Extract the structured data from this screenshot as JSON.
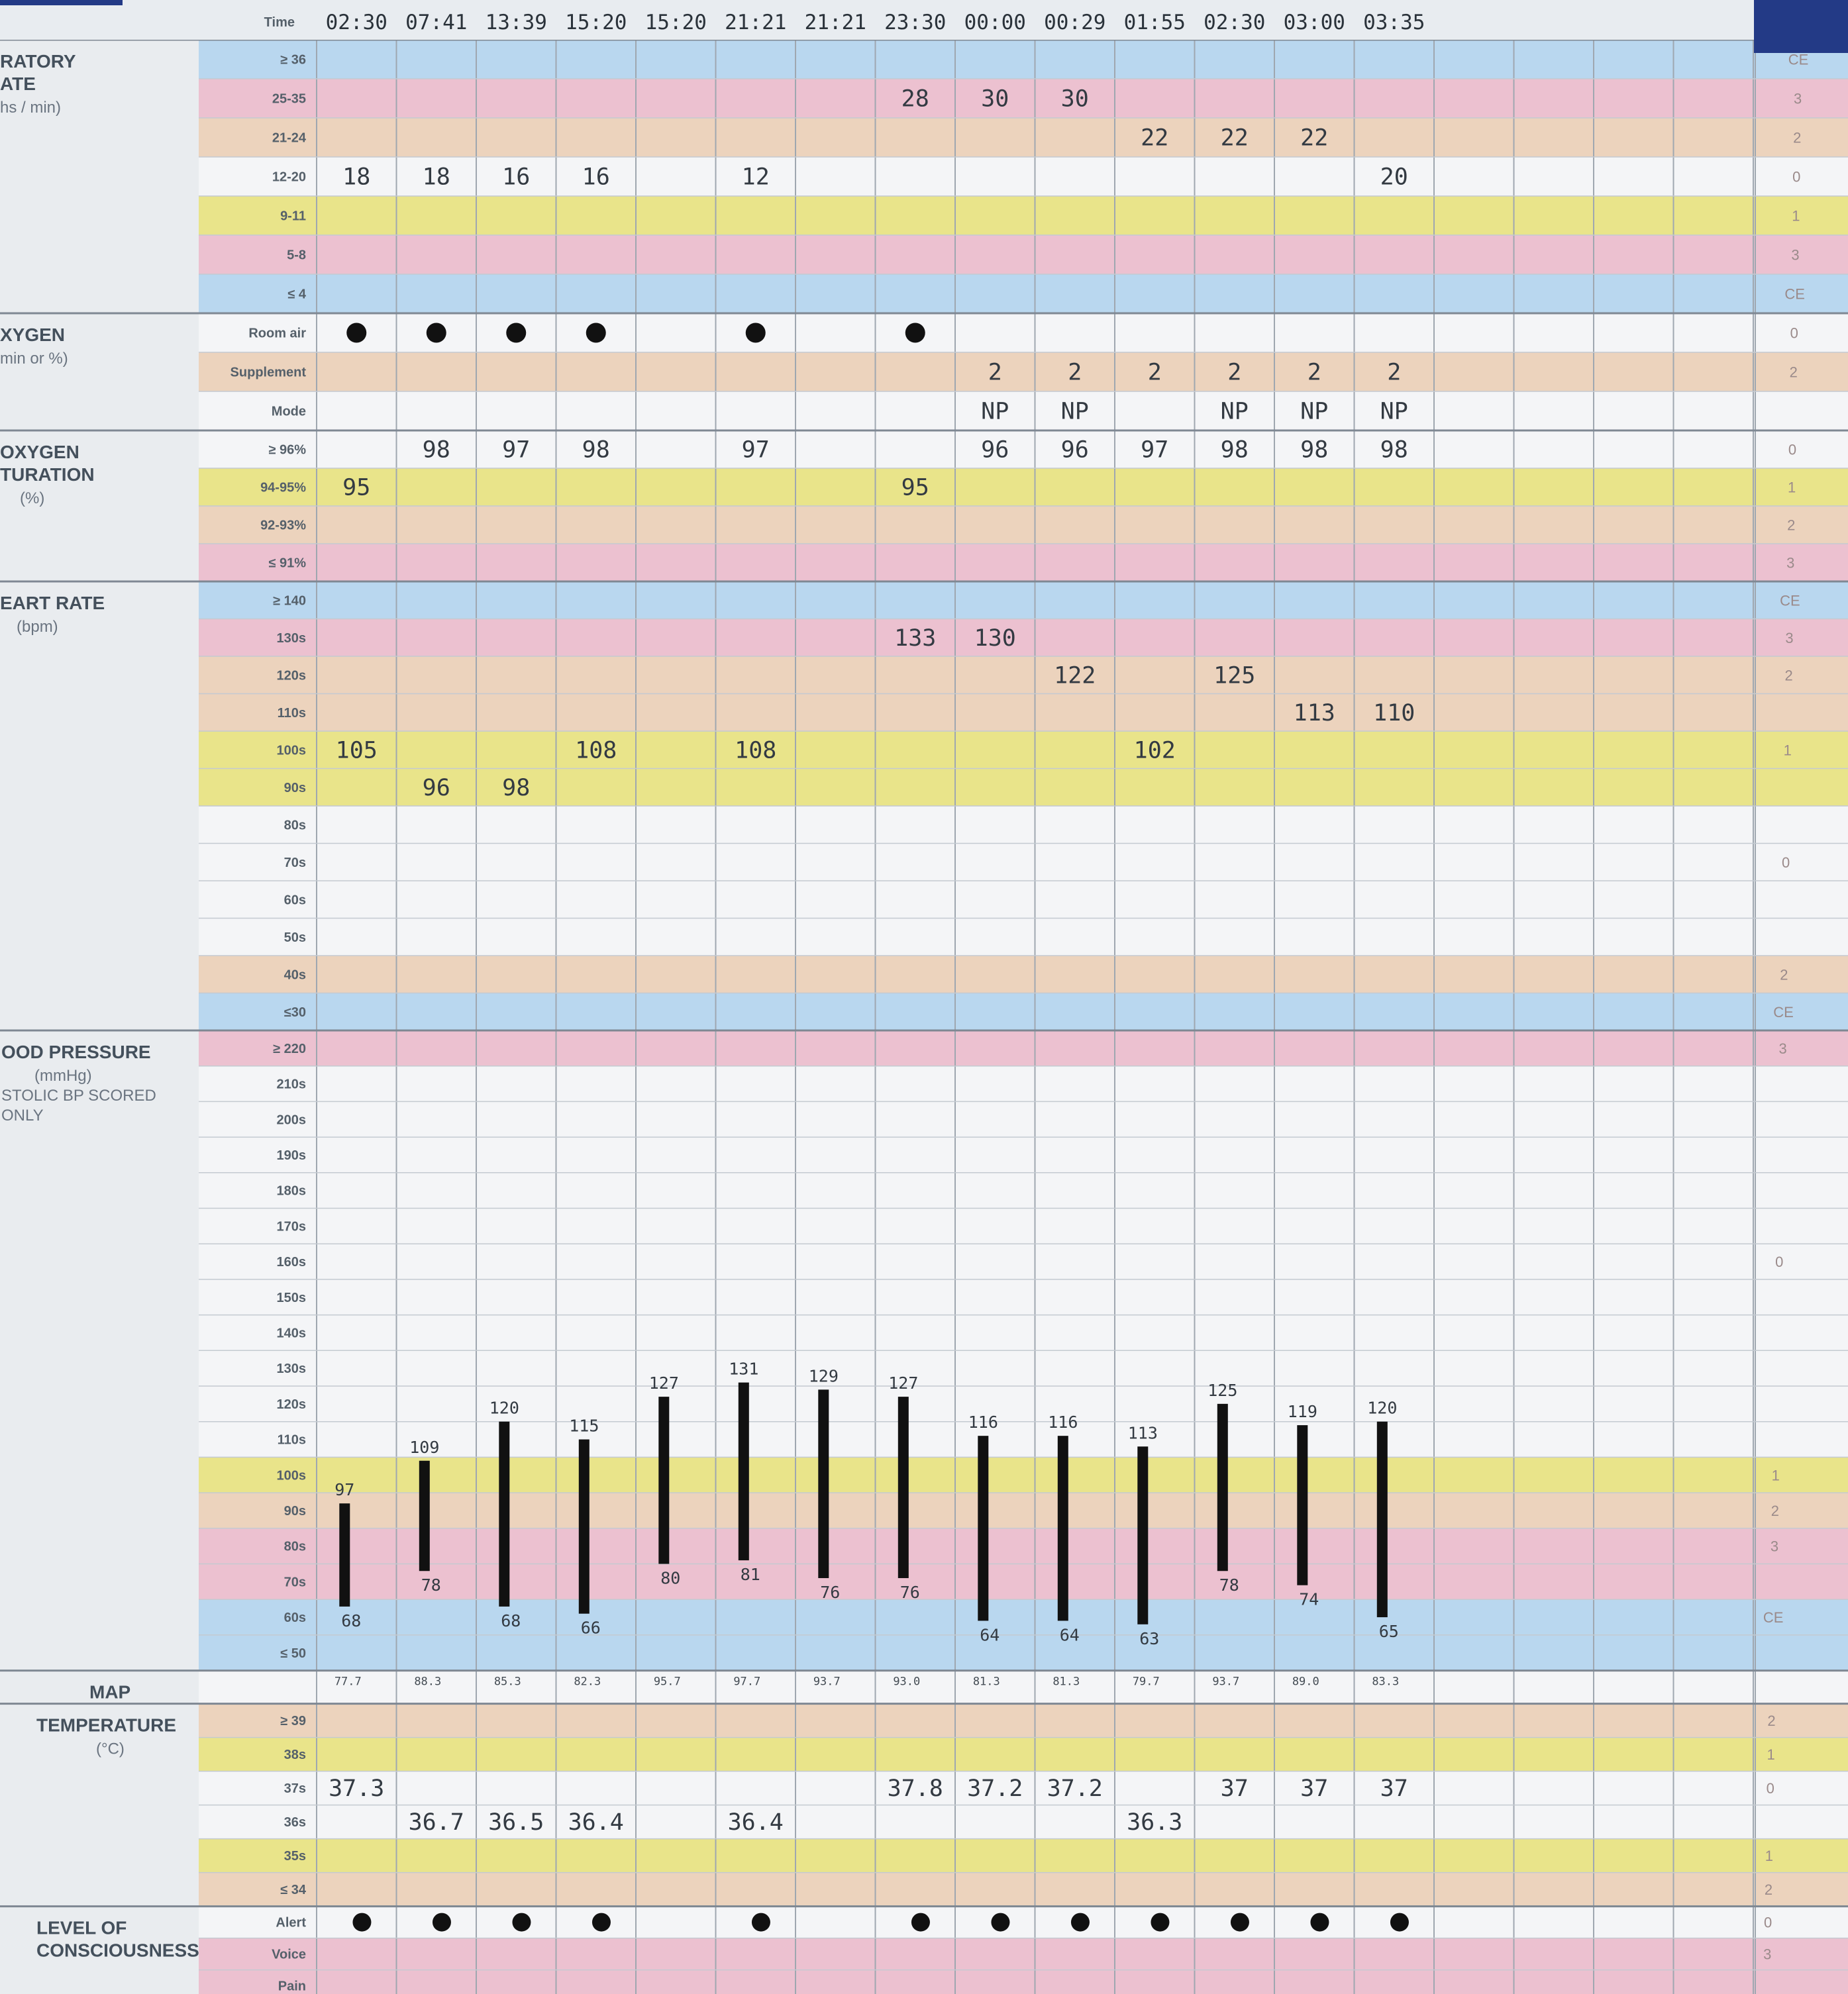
{
  "colors": {
    "blue": "#b9d7ef",
    "pink": "#ecc1d0",
    "peach": "#ecd3bd",
    "yellow": "#e9e48a",
    "white": "#f4f5f7",
    "grid": "#9fa7b0",
    "header_navy": "#233a86",
    "bar": "#111111",
    "dot": "#111111"
  },
  "header": {
    "time_label": "Time"
  },
  "times": [
    "02:30",
    "07:41",
    "13:39",
    "15:20",
    "15:20",
    "21:21",
    "21:21",
    "23:30",
    "00:00",
    "00:29",
    "01:55",
    "02:30",
    "03:00",
    "03:35"
  ],
  "sections": [
    {
      "id": "resp",
      "title_lines": [
        "RATORY",
        "ATE"
      ],
      "sub_lines": [
        "hs / min)"
      ]
    },
    {
      "id": "oxygen",
      "title_lines": [
        "XYGEN"
      ],
      "sub_lines": [
        "min or %)"
      ]
    },
    {
      "id": "sat",
      "title_lines": [
        "OXYGEN",
        "TURATION"
      ],
      "sub_lines": [
        "(%)"
      ]
    },
    {
      "id": "hr",
      "title_lines": [
        "EART RATE"
      ],
      "sub_lines": [
        "(bpm)"
      ]
    },
    {
      "id": "bp",
      "title_lines": [
        "OOD PRESSURE"
      ],
      "sub_lines": [
        "(mmHg)",
        "STOLIC BP SCORED",
        "ONLY"
      ]
    },
    {
      "id": "map",
      "title_lines": [
        "MAP"
      ],
      "sub_lines": []
    },
    {
      "id": "temp",
      "title_lines": [
        "TEMPERATURE"
      ],
      "sub_lines": [
        "(°C)"
      ]
    },
    {
      "id": "loc",
      "title_lines": [
        "LEVEL OF",
        "CONSCIOUSNESS"
      ],
      "sub_lines": []
    }
  ],
  "rows": [
    {
      "section": "resp",
      "label": "≥ 36",
      "color": "blue",
      "score": "CE"
    },
    {
      "section": "resp",
      "label": "25-35",
      "color": "pink",
      "score": "3"
    },
    {
      "section": "resp",
      "label": "21-24",
      "color": "peach",
      "score": "2"
    },
    {
      "section": "resp",
      "label": "12-20",
      "color": "white",
      "score": "0"
    },
    {
      "section": "resp",
      "label": "9-11",
      "color": "yellow",
      "score": "1"
    },
    {
      "section": "resp",
      "label": "5-8",
      "color": "pink",
      "score": "3"
    },
    {
      "section": "resp",
      "label": "≤ 4",
      "color": "blue",
      "score": "CE"
    },
    {
      "section": "oxygen",
      "label": "Room air",
      "color": "white",
      "score": "0"
    },
    {
      "section": "oxygen",
      "label": "Supplement",
      "color": "peach",
      "score": "2"
    },
    {
      "section": "oxygen",
      "label": "Mode",
      "color": "white",
      "score": ""
    },
    {
      "section": "sat",
      "label": "≥ 96%",
      "color": "white",
      "score": "0"
    },
    {
      "section": "sat",
      "label": "94-95%",
      "color": "yellow",
      "score": "1"
    },
    {
      "section": "sat",
      "label": "92-93%",
      "color": "peach",
      "score": "2"
    },
    {
      "section": "sat",
      "label": "≤ 91%",
      "color": "pink",
      "score": "3"
    },
    {
      "section": "hr",
      "label": "≥ 140",
      "color": "blue",
      "score": "CE"
    },
    {
      "section": "hr",
      "label": "130s",
      "color": "pink",
      "score": "3"
    },
    {
      "section": "hr",
      "label": "120s",
      "color": "peach",
      "score": "2"
    },
    {
      "section": "hr",
      "label": "110s",
      "color": "peach",
      "score": ""
    },
    {
      "section": "hr",
      "label": "100s",
      "color": "yellow",
      "score": "1"
    },
    {
      "section": "hr",
      "label": "90s",
      "color": "yellow",
      "score": ""
    },
    {
      "section": "hr",
      "label": "80s",
      "color": "white",
      "score": ""
    },
    {
      "section": "hr",
      "label": "70s",
      "color": "white",
      "score": "0"
    },
    {
      "section": "hr",
      "label": "60s",
      "color": "white",
      "score": ""
    },
    {
      "section": "hr",
      "label": "50s",
      "color": "white",
      "score": ""
    },
    {
      "section": "hr",
      "label": "40s",
      "color": "peach",
      "score": "2"
    },
    {
      "section": "hr",
      "label": "≤30",
      "color": "blue",
      "score": "CE"
    },
    {
      "section": "bp",
      "label": "≥ 220",
      "color": "pink",
      "score": "3"
    },
    {
      "section": "bp",
      "label": "210s",
      "color": "white",
      "score": ""
    },
    {
      "section": "bp",
      "label": "200s",
      "color": "white",
      "score": ""
    },
    {
      "section": "bp",
      "label": "190s",
      "color": "white",
      "score": ""
    },
    {
      "section": "bp",
      "label": "180s",
      "color": "white",
      "score": ""
    },
    {
      "section": "bp",
      "label": "170s",
      "color": "white",
      "score": ""
    },
    {
      "section": "bp",
      "label": "160s",
      "color": "white",
      "score": "0"
    },
    {
      "section": "bp",
      "label": "150s",
      "color": "white",
      "score": ""
    },
    {
      "section": "bp",
      "label": "140s",
      "color": "white",
      "score": ""
    },
    {
      "section": "bp",
      "label": "130s",
      "color": "white",
      "score": ""
    },
    {
      "section": "bp",
      "label": "120s",
      "color": "white",
      "score": ""
    },
    {
      "section": "bp",
      "label": "110s",
      "color": "white",
      "score": ""
    },
    {
      "section": "bp",
      "label": "100s",
      "color": "yellow",
      "score": "1"
    },
    {
      "section": "bp",
      "label": "90s",
      "color": "peach",
      "score": "2"
    },
    {
      "section": "bp",
      "label": "80s",
      "color": "pink",
      "score": "3"
    },
    {
      "section": "bp",
      "label": "70s",
      "color": "pink",
      "score": ""
    },
    {
      "section": "bp",
      "label": "60s",
      "color": "blue",
      "score": "CE"
    },
    {
      "section": "bp",
      "label": "≤ 50",
      "color": "blue",
      "score": ""
    },
    {
      "section": "map",
      "label": "",
      "color": "white",
      "score": ""
    },
    {
      "section": "temp",
      "label": "≥ 39",
      "color": "peach",
      "score": "2"
    },
    {
      "section": "temp",
      "label": "38s",
      "color": "yellow",
      "score": "1"
    },
    {
      "section": "temp",
      "label": "37s",
      "color": "white",
      "score": "0"
    },
    {
      "section": "temp",
      "label": "36s",
      "color": "white",
      "score": ""
    },
    {
      "section": "temp",
      "label": "35s",
      "color": "yellow",
      "score": "1"
    },
    {
      "section": "temp",
      "label": "≤ 34",
      "color": "peach",
      "score": "2"
    },
    {
      "section": "loc",
      "label": "Alert",
      "color": "white",
      "score": "0"
    },
    {
      "section": "loc",
      "label": "Voice",
      "color": "pink",
      "score": "3"
    },
    {
      "section": "loc",
      "label": "Pain",
      "color": "pink",
      "score": ""
    }
  ],
  "values": {
    "resp": [
      {
        "col": 0,
        "row": "12-20",
        "v": "18"
      },
      {
        "col": 1,
        "row": "12-20",
        "v": "18"
      },
      {
        "col": 2,
        "row": "12-20",
        "v": "16"
      },
      {
        "col": 3,
        "row": "12-20",
        "v": "16"
      },
      {
        "col": 5,
        "row": "12-20",
        "v": "12"
      },
      {
        "col": 7,
        "row": "25-35",
        "v": "28"
      },
      {
        "col": 8,
        "row": "25-35",
        "v": "30"
      },
      {
        "col": 9,
        "row": "25-35",
        "v": "30"
      },
      {
        "col": 10,
        "row": "21-24",
        "v": "22"
      },
      {
        "col": 11,
        "row": "21-24",
        "v": "22"
      },
      {
        "col": 12,
        "row": "21-24",
        "v": "22"
      },
      {
        "col": 13,
        "row": "12-20",
        "v": "20"
      }
    ],
    "room_air_cols": [
      0,
      1,
      2,
      3,
      5,
      7
    ],
    "supplement": [
      {
        "col": 8,
        "v": "2"
      },
      {
        "col": 9,
        "v": "2"
      },
      {
        "col": 10,
        "v": "2"
      },
      {
        "col": 11,
        "v": "2"
      },
      {
        "col": 12,
        "v": "2"
      },
      {
        "col": 13,
        "v": "2"
      }
    ],
    "mode": [
      {
        "col": 8,
        "v": "NP"
      },
      {
        "col": 9,
        "v": "NP"
      },
      {
        "col": 11,
        "v": "NP"
      },
      {
        "col": 12,
        "v": "NP"
      },
      {
        "col": 13,
        "v": "NP"
      }
    ],
    "sat": [
      {
        "col": 0,
        "row": "94-95%",
        "v": "95"
      },
      {
        "col": 1,
        "row": "≥ 96%",
        "v": "98"
      },
      {
        "col": 2,
        "row": "≥ 96%",
        "v": "97"
      },
      {
        "col": 3,
        "row": "≥ 96%",
        "v": "98"
      },
      {
        "col": 5,
        "row": "≥ 96%",
        "v": "97"
      },
      {
        "col": 7,
        "row": "94-95%",
        "v": "95"
      },
      {
        "col": 8,
        "row": "≥ 96%",
        "v": "96"
      },
      {
        "col": 9,
        "row": "≥ 96%",
        "v": "96"
      },
      {
        "col": 10,
        "row": "≥ 96%",
        "v": "97"
      },
      {
        "col": 11,
        "row": "≥ 96%",
        "v": "98"
      },
      {
        "col": 12,
        "row": "≥ 96%",
        "v": "98"
      },
      {
        "col": 13,
        "row": "≥ 96%",
        "v": "98"
      }
    ],
    "hr": [
      {
        "col": 0,
        "row": "100s",
        "v": "105"
      },
      {
        "col": 1,
        "row": "90s",
        "v": "96"
      },
      {
        "col": 2,
        "row": "90s",
        "v": "98"
      },
      {
        "col": 3,
        "row": "100s",
        "v": "108"
      },
      {
        "col": 5,
        "row": "100s",
        "v": "108"
      },
      {
        "col": 7,
        "row": "130s",
        "v": "133"
      },
      {
        "col": 8,
        "row": "130s",
        "v": "130"
      },
      {
        "col": 9,
        "row": "120s",
        "v": "122"
      },
      {
        "col": 10,
        "row": "100s",
        "v": "102"
      },
      {
        "col": 11,
        "row": "120s",
        "v": "125"
      },
      {
        "col": 12,
        "row": "110s",
        "v": "113"
      },
      {
        "col": 13,
        "row": "110s",
        "v": "110"
      }
    ],
    "temp": [
      {
        "col": 0,
        "row": "37s",
        "v": "37.3"
      },
      {
        "col": 1,
        "row": "36s",
        "v": "36.7"
      },
      {
        "col": 2,
        "row": "36s",
        "v": "36.5"
      },
      {
        "col": 3,
        "row": "36s",
        "v": "36.4"
      },
      {
        "col": 5,
        "row": "36s",
        "v": "36.4"
      },
      {
        "col": 7,
        "row": "37s",
        "v": "37.8"
      },
      {
        "col": 8,
        "row": "37s",
        "v": "37.2"
      },
      {
        "col": 9,
        "row": "37s",
        "v": "37.2"
      },
      {
        "col": 10,
        "row": "36s",
        "v": "36.3"
      },
      {
        "col": 11,
        "row": "37s",
        "v": "37"
      },
      {
        "col": 12,
        "row": "37s",
        "v": "37"
      },
      {
        "col": 13,
        "row": "37s",
        "v": "37"
      }
    ],
    "alert_cols": [
      1,
      2,
      3,
      4,
      6,
      8,
      9,
      10,
      11,
      12,
      13,
      14
    ]
  },
  "chart_data": {
    "type": "bar",
    "title": "",
    "xlabel": "",
    "ylabel": "",
    "series": [
      {
        "name": "",
        "values": [
          {
            "slot": 0.6,
            "sys": 97,
            "dia": 68
          },
          {
            "slot": 1.6,
            "sys": 109,
            "dia": 78
          },
          {
            "slot": 2.6,
            "sys": 120,
            "dia": 68
          },
          {
            "slot": 3.6,
            "sys": 115,
            "dia": 66
          },
          {
            "slot": 4.6,
            "sys": 127,
            "dia": 80
          },
          {
            "slot": 5.6,
            "sys": 131,
            "dia": 81
          },
          {
            "slot": 6.6,
            "sys": 129,
            "dia": 76
          },
          {
            "slot": 7.6,
            "sys": 127,
            "dia": 76
          },
          {
            "slot": 8.6,
            "sys": 116,
            "dia": 64
          },
          {
            "slot": 9.6,
            "sys": 116,
            "dia": 64
          },
          {
            "slot": 10.6,
            "sys": 113,
            "dia": 63
          },
          {
            "slot": 11.6,
            "sys": 125,
            "dia": 78
          },
          {
            "slot": 12.6,
            "sys": 119,
            "dia": 74
          },
          {
            "slot": 13.6,
            "sys": 120,
            "dia": 65
          }
        ]
      }
    ],
    "map": [
      "77.7",
      "88.3",
      "85.3",
      "82.3",
      "95.7",
      "97.7",
      "93.7",
      "93.0",
      "81.3",
      "81.3",
      "79.7",
      "93.7",
      "89.0",
      "83.3"
    ]
  }
}
